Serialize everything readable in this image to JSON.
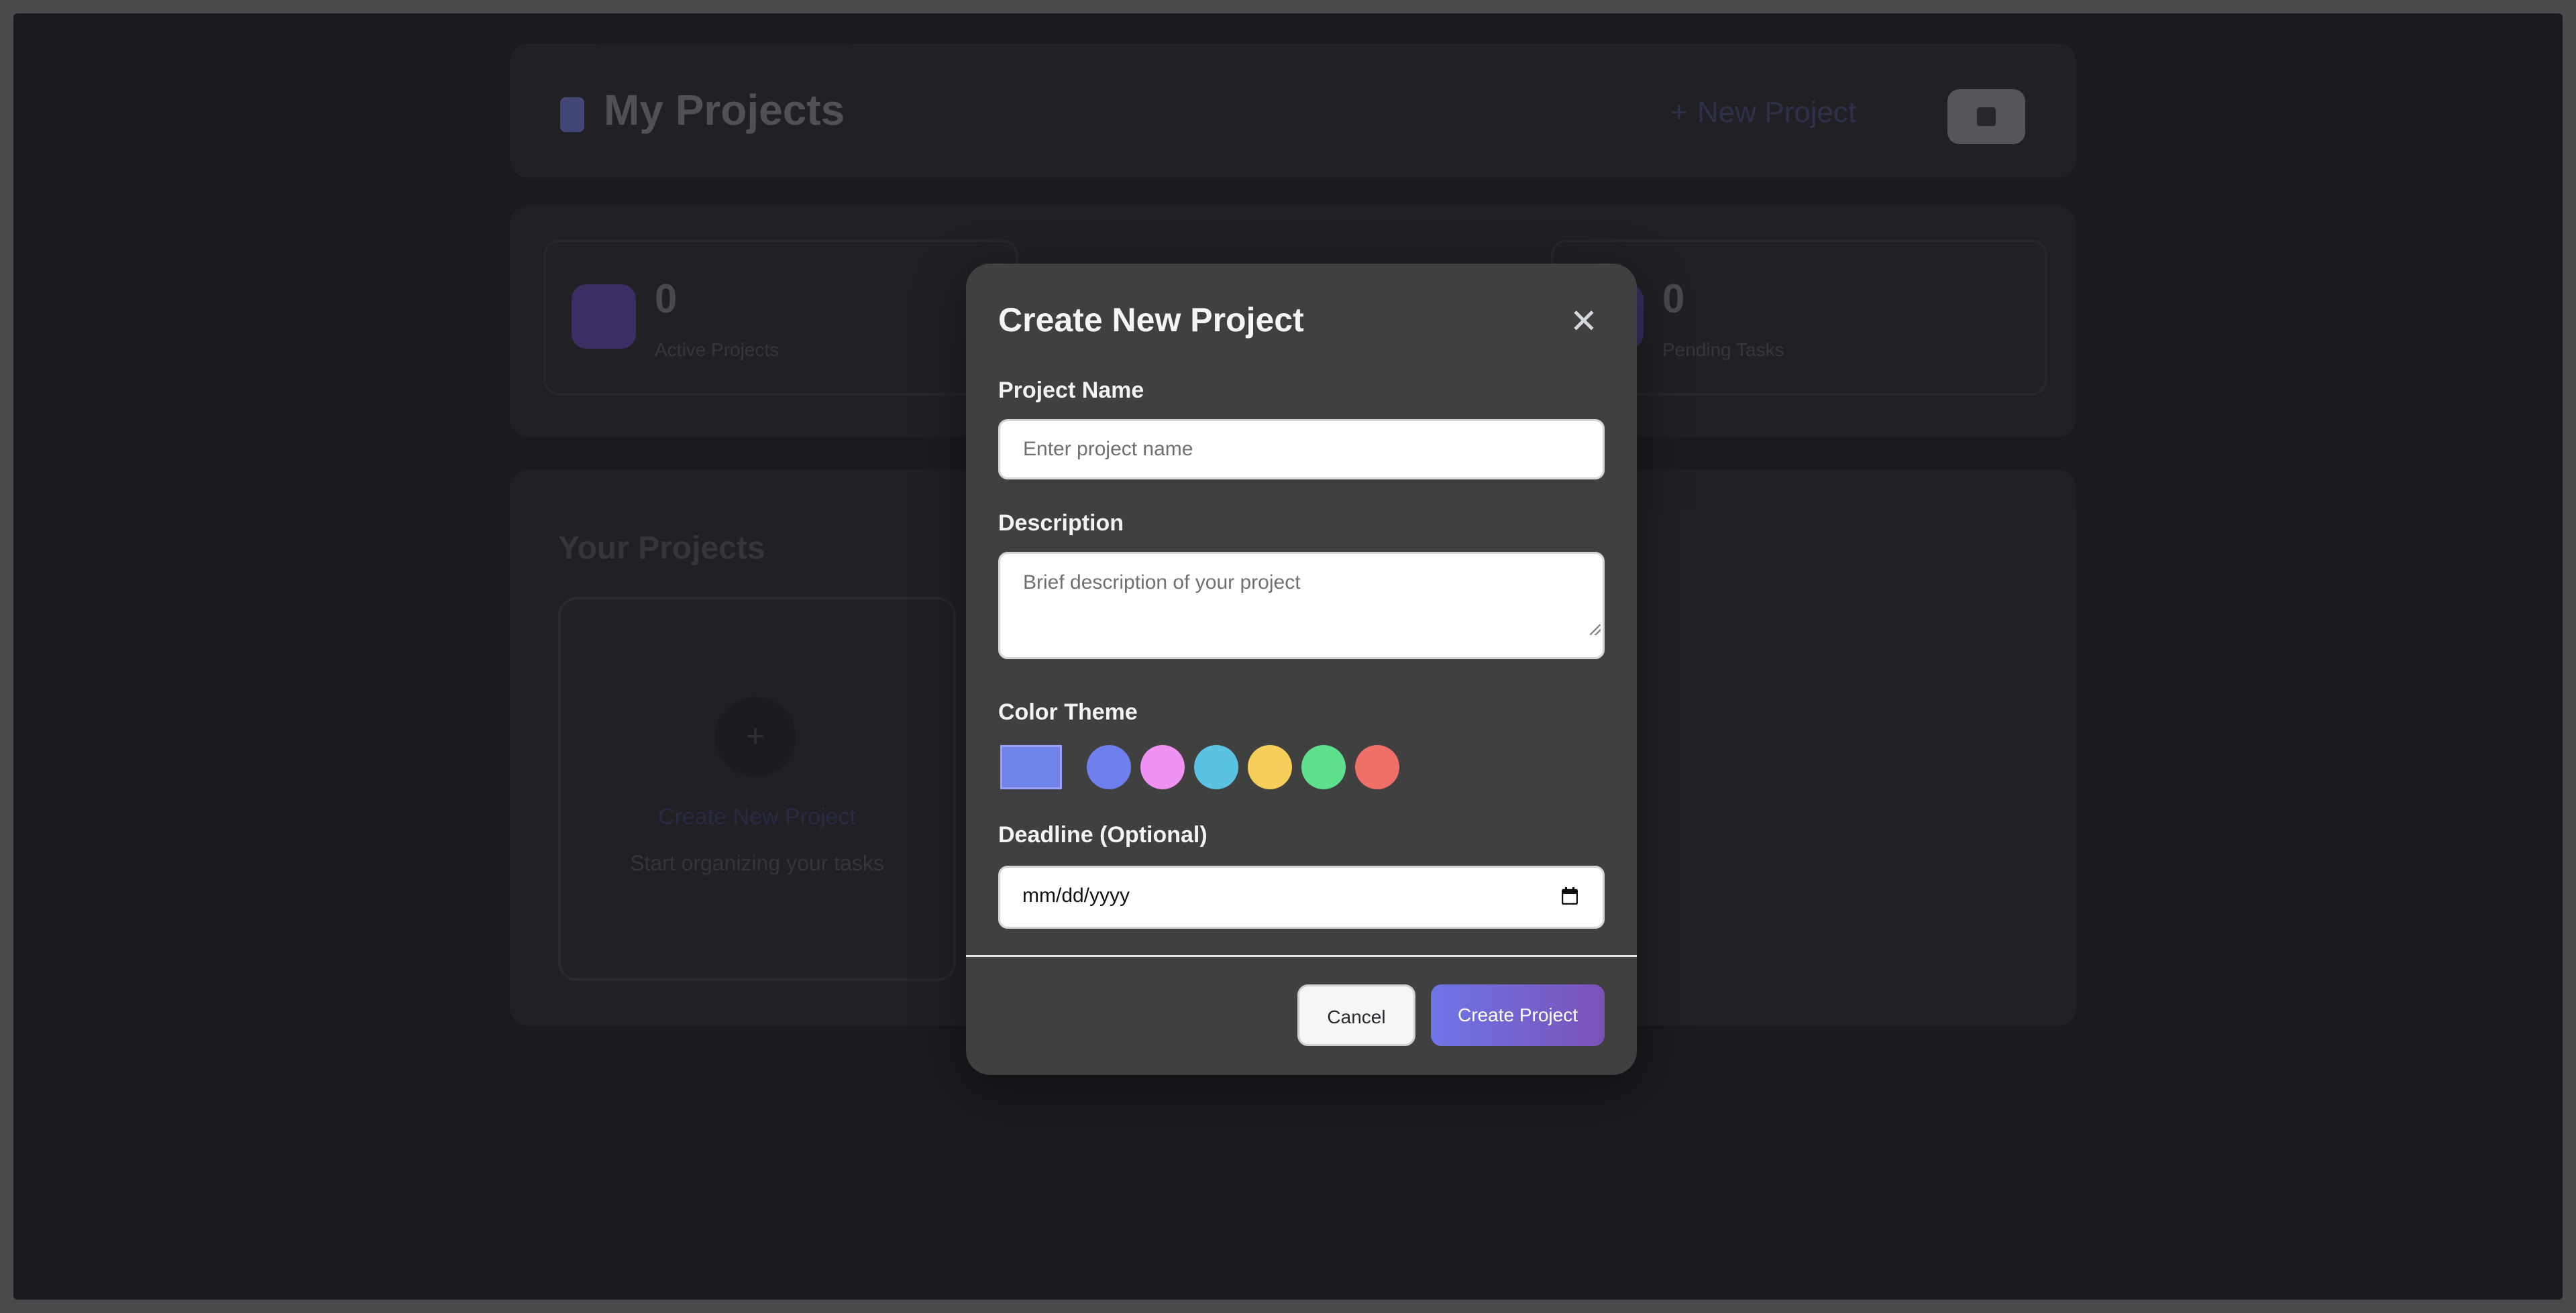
{
  "background": {
    "header": {
      "title": "My Projects",
      "new_project_label": "New Project",
      "new_project_plus": "+"
    },
    "stats": [
      {
        "value": "0",
        "label": "Active Projects"
      },
      {
        "value": "0",
        "label": "Pending Tasks"
      }
    ],
    "projects_section": {
      "title": "Your Projects",
      "new_card_plus": "+",
      "new_card_title": "Create New Project",
      "new_card_subtitle": "Start organizing your tasks"
    }
  },
  "modal": {
    "title": "Create New Project",
    "close_glyph": "✕",
    "project_name": {
      "label": "Project Name",
      "placeholder": "Enter project name",
      "value": ""
    },
    "description": {
      "label": "Description",
      "placeholder": "Brief description of your project",
      "value": ""
    },
    "color_theme": {
      "label": "Color Theme",
      "selected_color": "#6f82e8",
      "options": [
        "#6f80ee",
        "#f092f2",
        "#5cc2e2",
        "#f5cf5a",
        "#5fe08f",
        "#f07067"
      ]
    },
    "deadline": {
      "label": "Deadline (Optional)",
      "value_text": "mm/dd/yyyy"
    },
    "buttons": {
      "cancel": "Cancel",
      "create": "Create Project"
    }
  }
}
